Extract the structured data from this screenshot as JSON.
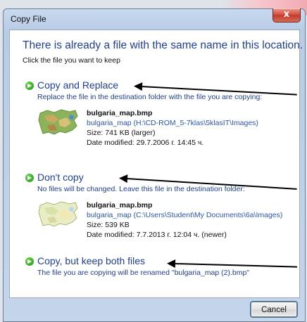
{
  "window": {
    "title": "Copy File",
    "close_label": "x"
  },
  "heading": "There is already a file with the same name in this location.",
  "subheading": "Click the file you want to keep",
  "options": [
    {
      "title": "Copy and Replace",
      "description": "Replace the file in the destination folder with the file you are copying:",
      "file": {
        "name": "bulgaria_map.bmp",
        "path": "bulgaria_map (H:\\CD-ROM_5-7klas\\5klasIT\\Images)",
        "size": "Size: 741 KB (larger)",
        "modified": "Date modified: 29.7.2006 г. 14:45 ч."
      },
      "thumbnail": "bulgaria-map-colored"
    },
    {
      "title": "Don't copy",
      "description": "No files will be changed. Leave this file in the destination folder:",
      "file": {
        "name": "bulgaria_map.bmp",
        "path": "bulgaria_map (C:\\Users\\Student\\My Documents\\6a\\Images)",
        "size": "Size: 539 KB",
        "modified": "Date modified: 7.7.2013 г. 12:04 ч. (newer)"
      },
      "thumbnail": "bulgaria-map-pale"
    },
    {
      "title": "Copy, but keep both files",
      "description": "The file you are copying will be renamed \"bulgaria_map (2).bmp\""
    }
  ],
  "buttons": {
    "cancel": "Cancel"
  },
  "colors": {
    "link_blue": "#1f3f9a",
    "path_blue": "#2b55b5",
    "green_arrow": "#2aa51f"
  }
}
